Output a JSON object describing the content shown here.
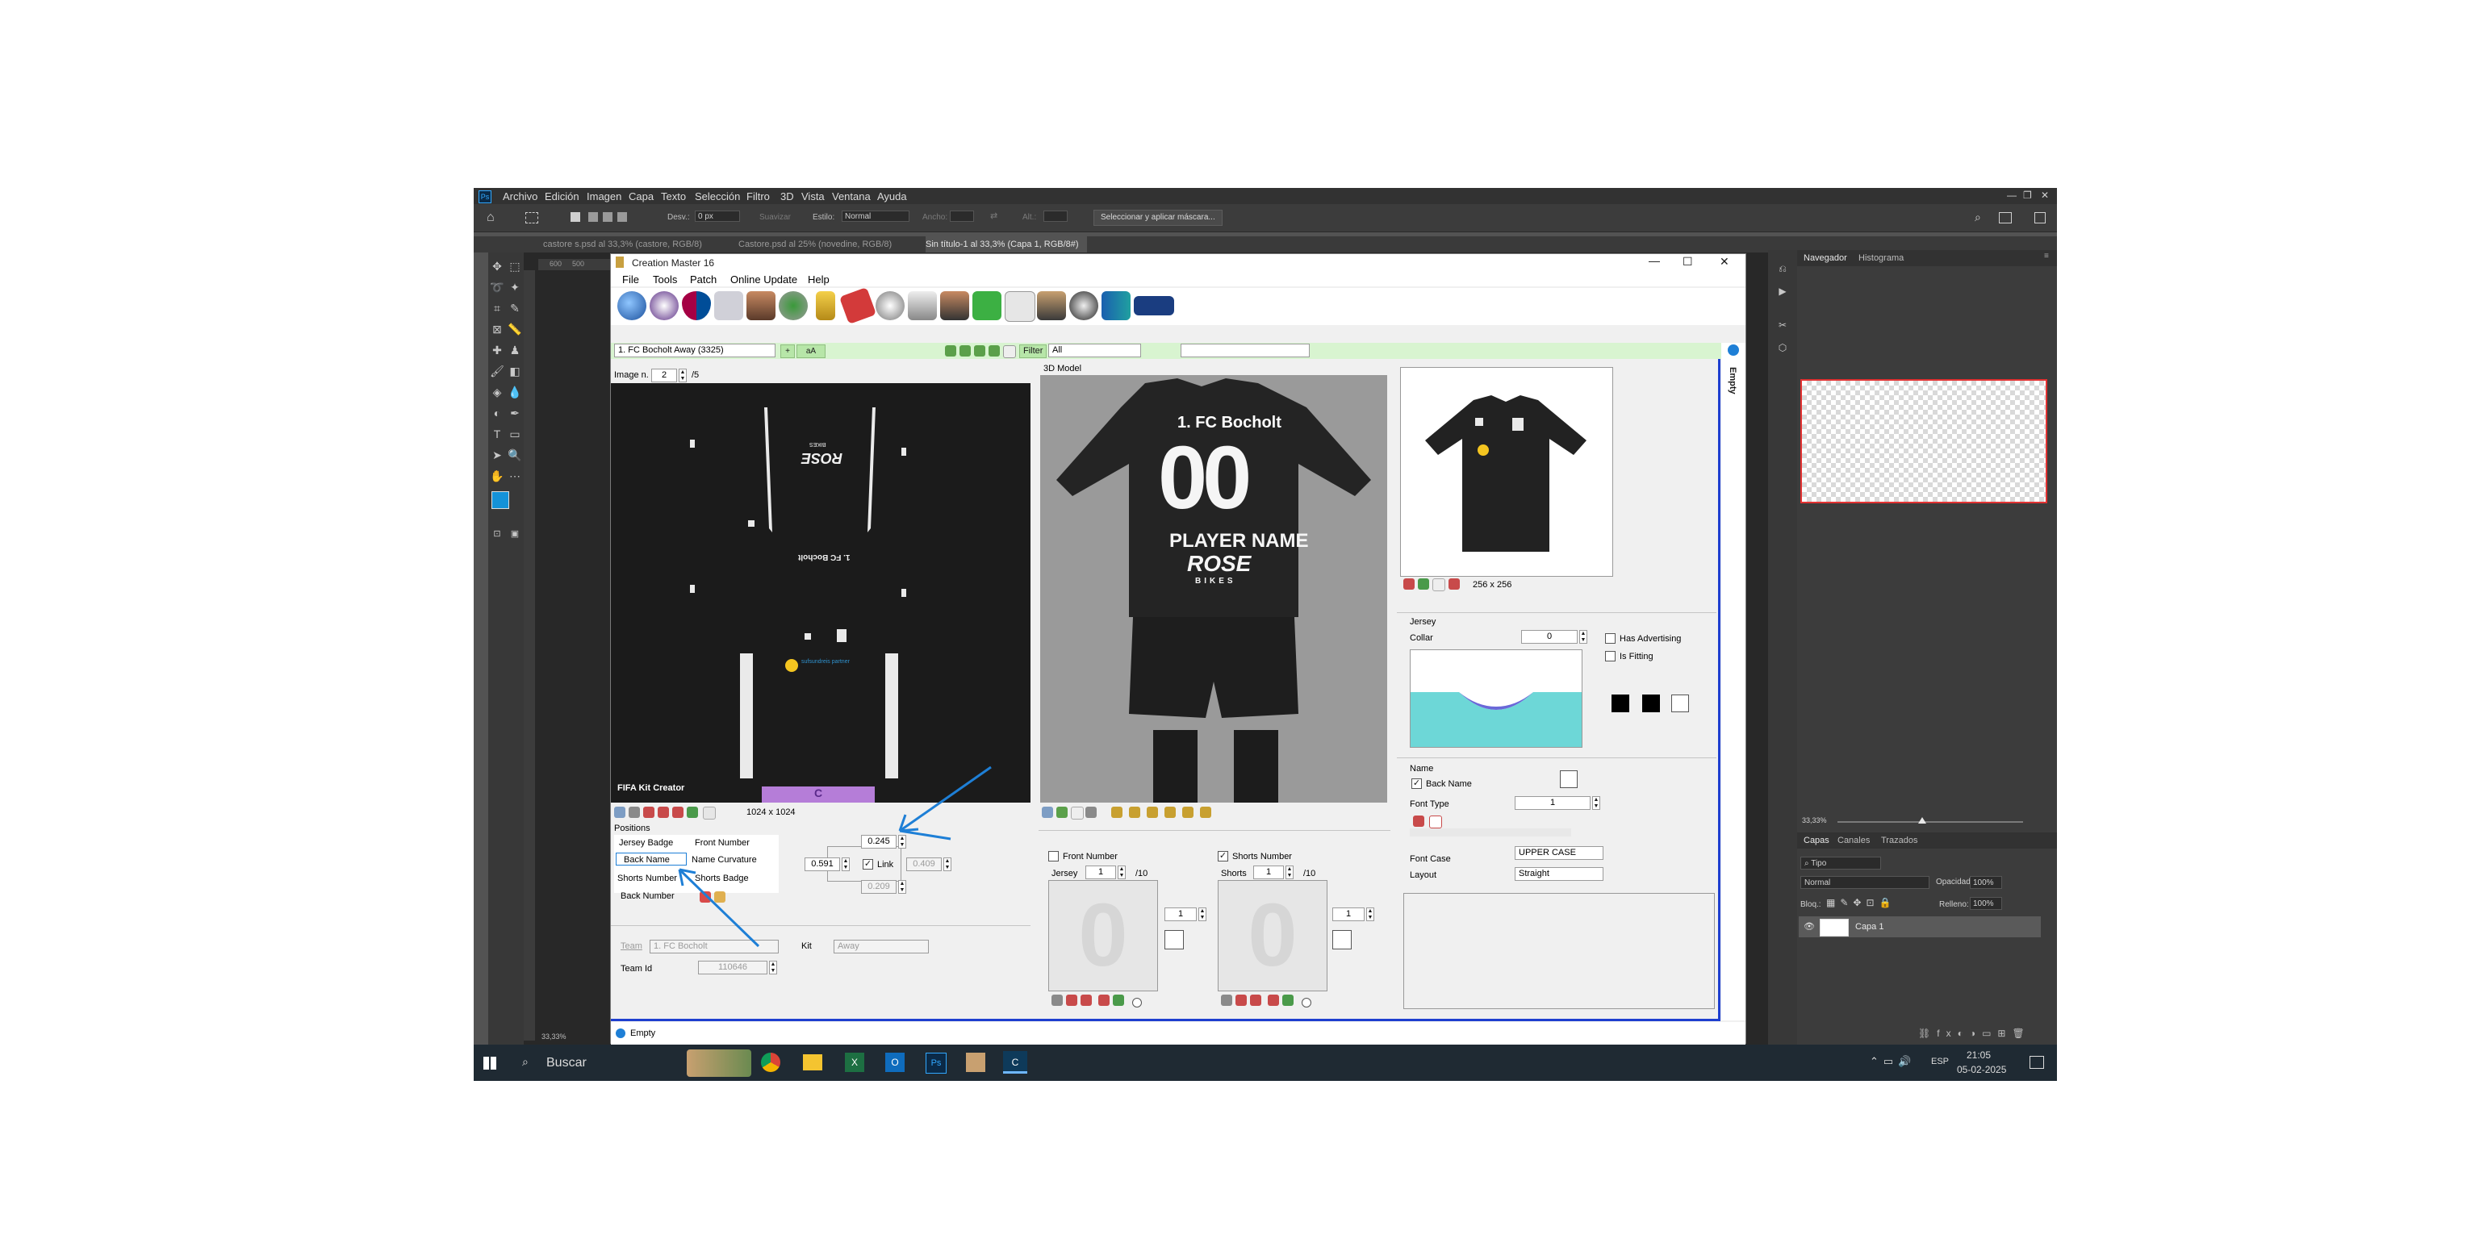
{
  "photoshop": {
    "menu": [
      "Archivo",
      "Edición",
      "Imagen",
      "Capa",
      "Texto",
      "Selección",
      "Filtro",
      "3D",
      "Vista",
      "Ventana",
      "Ayuda"
    ],
    "options": {
      "desv_label": "Desv.:",
      "desv_value": "0 px",
      "suavizar_label": "Suavizar",
      "estilo_label": "Estilo:",
      "estilo_value": "Normal",
      "ancho_label": "Ancho:",
      "alto_label": "Alt.:",
      "mask_button": "Seleccionar y aplicar máscara..."
    },
    "tabs": [
      "castore s.psd al 33,3% (castore, RGB/8)",
      "Castore.psd al 25% (novedine, RGB/8)",
      "Sin título-1 al 33,3% (Capa 1, RGB/8#)"
    ],
    "ruler": [
      "600",
      "500"
    ],
    "zoom_status": "33,33%",
    "panels": {
      "navigator_tab": "Navegador",
      "histogram_tab": "Histograma",
      "nav_zoom": "33,33%",
      "layers_tab": "Capas",
      "channels_tab": "Canales",
      "paths_tab": "Trazados",
      "kind_filter": "Tipo",
      "blend_mode": "Normal",
      "opacity_label": "Opacidad:",
      "opacity_value": "100%",
      "lock_label": "Bloq.:",
      "fill_label": "Relleno:",
      "fill_value": "100%",
      "layer_name": "Capa 1"
    }
  },
  "cm": {
    "title": "Creation Master 16",
    "menu": [
      "File",
      "Tools",
      "Patch",
      "Online Update",
      "Help"
    ],
    "team_select": "1. FC Bocholt Away (3325)",
    "aa_button": "aA",
    "filter_label": "Filter",
    "filter_value": "All",
    "image_label": "Image n.",
    "image_value": "2",
    "image_total": "/5",
    "texture_watermark": "FIFA Kit Creator",
    "texture_size": "1024 x 1024",
    "positions_label": "Positions",
    "positions": {
      "jersey_badge": "Jersey Badge",
      "front_number": "Front Number",
      "back_name": "Back Name",
      "name_curvature": "Name Curvature",
      "shorts_number": "Shorts Number",
      "shorts_badge": "Shorts Badge",
      "back_number": "Back Number"
    },
    "pos_values": {
      "top": "0.245",
      "left": "0.591",
      "link_label": "Link",
      "right": "0.409",
      "bottom": "0.209"
    },
    "team_label": "Team",
    "team_value": "1. FC Bocholt",
    "kit_label": "Kit",
    "kit_value": "Away",
    "team_id_label": "Team Id",
    "team_id_value": "110646",
    "model_label": "3D Model",
    "kit_text": {
      "club": "1. FC Bocholt",
      "number": "00",
      "name": "PLAYER NAME",
      "sponsor1": "ROSE",
      "sponsor2": "BIKES"
    },
    "preview_size": "256 x 256",
    "jersey_group": "Jersey",
    "collar_label": "Collar",
    "collar_value": "0",
    "has_advertising": "Has Advertising",
    "is_fitting": "Is Fitting",
    "name_group": "Name",
    "back_name_check": "Back Name",
    "font_type_label": "Font Type",
    "font_type_value": "1",
    "font_case_label": "Font Case",
    "font_case_value": "UPPER CASE",
    "layout_label": "Layout",
    "layout_value": "Straight",
    "front_number_check": "Front Number",
    "jersey_num_label": "Jersey",
    "jersey_num_value": "1",
    "jersey_num_total": "/10",
    "shorts_number_check": "Shorts Number",
    "shorts_num_label": "Shorts",
    "shorts_num_value": "1",
    "shorts_num_total": "/10",
    "left_spin": "1",
    "right_spin": "1",
    "empty_side": "Empty",
    "empty_status": "Empty",
    "texture_sponsor": "ROSE",
    "texture_sponsor_sub": "BIKES",
    "texture_club": "1. FC Bocholt",
    "texture_partner": "sufsundreis partner",
    "texture_letter": "C"
  },
  "taskbar": {
    "search": "Buscar",
    "lang": "ESP",
    "time": "21:05",
    "date": "05-02-2025"
  },
  "colors": {
    "ps_bg": "#535353",
    "accent_blue": "#1e7fd6",
    "teambar_green": "#d8f4d0",
    "collar_cyan": "#6dd7d7"
  }
}
